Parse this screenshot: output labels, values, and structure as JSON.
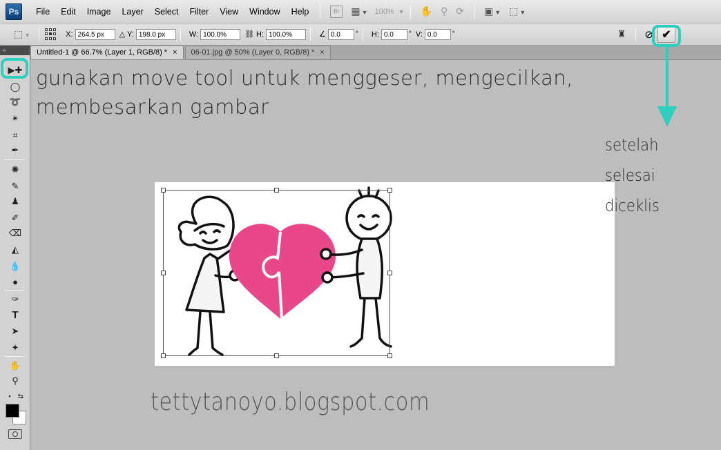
{
  "app": {
    "logo": "Ps"
  },
  "menu": [
    "File",
    "Edit",
    "Image",
    "Layer",
    "Select",
    "Filter",
    "View",
    "Window",
    "Help"
  ],
  "menubar": {
    "bridge_label": "Br",
    "zoom": "100%"
  },
  "options": {
    "x_label": "X:",
    "x_value": "264.5 px",
    "y_label": "Y:",
    "y_value": "198.0 px",
    "w_label": "W:",
    "w_value": "100.0%",
    "h_label": "H:",
    "h_value": "100.0%",
    "angle_value": "0.0",
    "hskew_label": "H:",
    "hskew_value": "0.0",
    "vskew_label": "V:",
    "vskew_value": "0.0",
    "degree": "°"
  },
  "tabs": [
    {
      "label": "Untitled-1 @ 66.7% (Layer 1, RGB/8) *",
      "close": "×"
    },
    {
      "label": "06-01.jpg @ 50% (Layer 0, RGB/8) *",
      "close": "×"
    }
  ],
  "annotations": {
    "main_line1": "gunakan move tool untuk menggeser, mengecilkan,",
    "main_line2": "membesarkan gambar",
    "side_line1": "setelah selesai",
    "side_line2": "diceklis",
    "watermark": "tettytanoyo.blogspot.com"
  },
  "colors": {
    "highlight": "#2fcfc0",
    "heart": "#e8478a",
    "foreground": "#000000",
    "background": "#ffffff"
  },
  "icons": {
    "tools": [
      "move-tool-icon",
      "marquee-tool-icon",
      "lasso-tool-icon",
      "magic-wand-icon",
      "crop-tool-icon",
      "eyedropper-icon",
      "spot-heal-icon",
      "brush-icon",
      "clone-stamp-icon",
      "history-brush-icon",
      "eraser-icon",
      "paint-bucket-icon",
      "blur-icon",
      "dodge-icon",
      "pen-tool-icon",
      "type-tool-icon",
      "path-select-icon",
      "custom-shape-icon",
      "hand-tool-icon",
      "zoom-tool-icon"
    ]
  }
}
